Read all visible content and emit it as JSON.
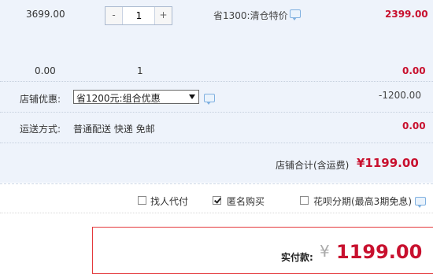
{
  "item": {
    "unit_price": "3699.00",
    "quantity": "1",
    "minus_label": "-",
    "plus_label": "+",
    "promo_text": "省1300:清仓特价",
    "subtotal": "2399.00"
  },
  "summary_row": {
    "price": "0.00",
    "count": "1",
    "amount": "0.00"
  },
  "shop_discount": {
    "label": "店铺优惠:",
    "selected_option": "省1200元:组合优惠",
    "amount": "-1200.00"
  },
  "shipping": {
    "label": "运送方式:",
    "value": "普通配送 快递 免邮",
    "amount": "0.00"
  },
  "shop_total": {
    "label": "店铺合计(含运费)",
    "amount": "¥1199.00"
  },
  "options": [
    {
      "label": "找人代付",
      "checked": false
    },
    {
      "label": "匿名购买",
      "checked": true
    },
    {
      "label": "花呗分期(最高3期免息)",
      "checked": false
    }
  ],
  "payment": {
    "label": "实付款:",
    "currency": "¥",
    "amount": "1199.00"
  },
  "colors": {
    "accent_red": "#c8102e",
    "panel_bg": "#eef3fb"
  }
}
